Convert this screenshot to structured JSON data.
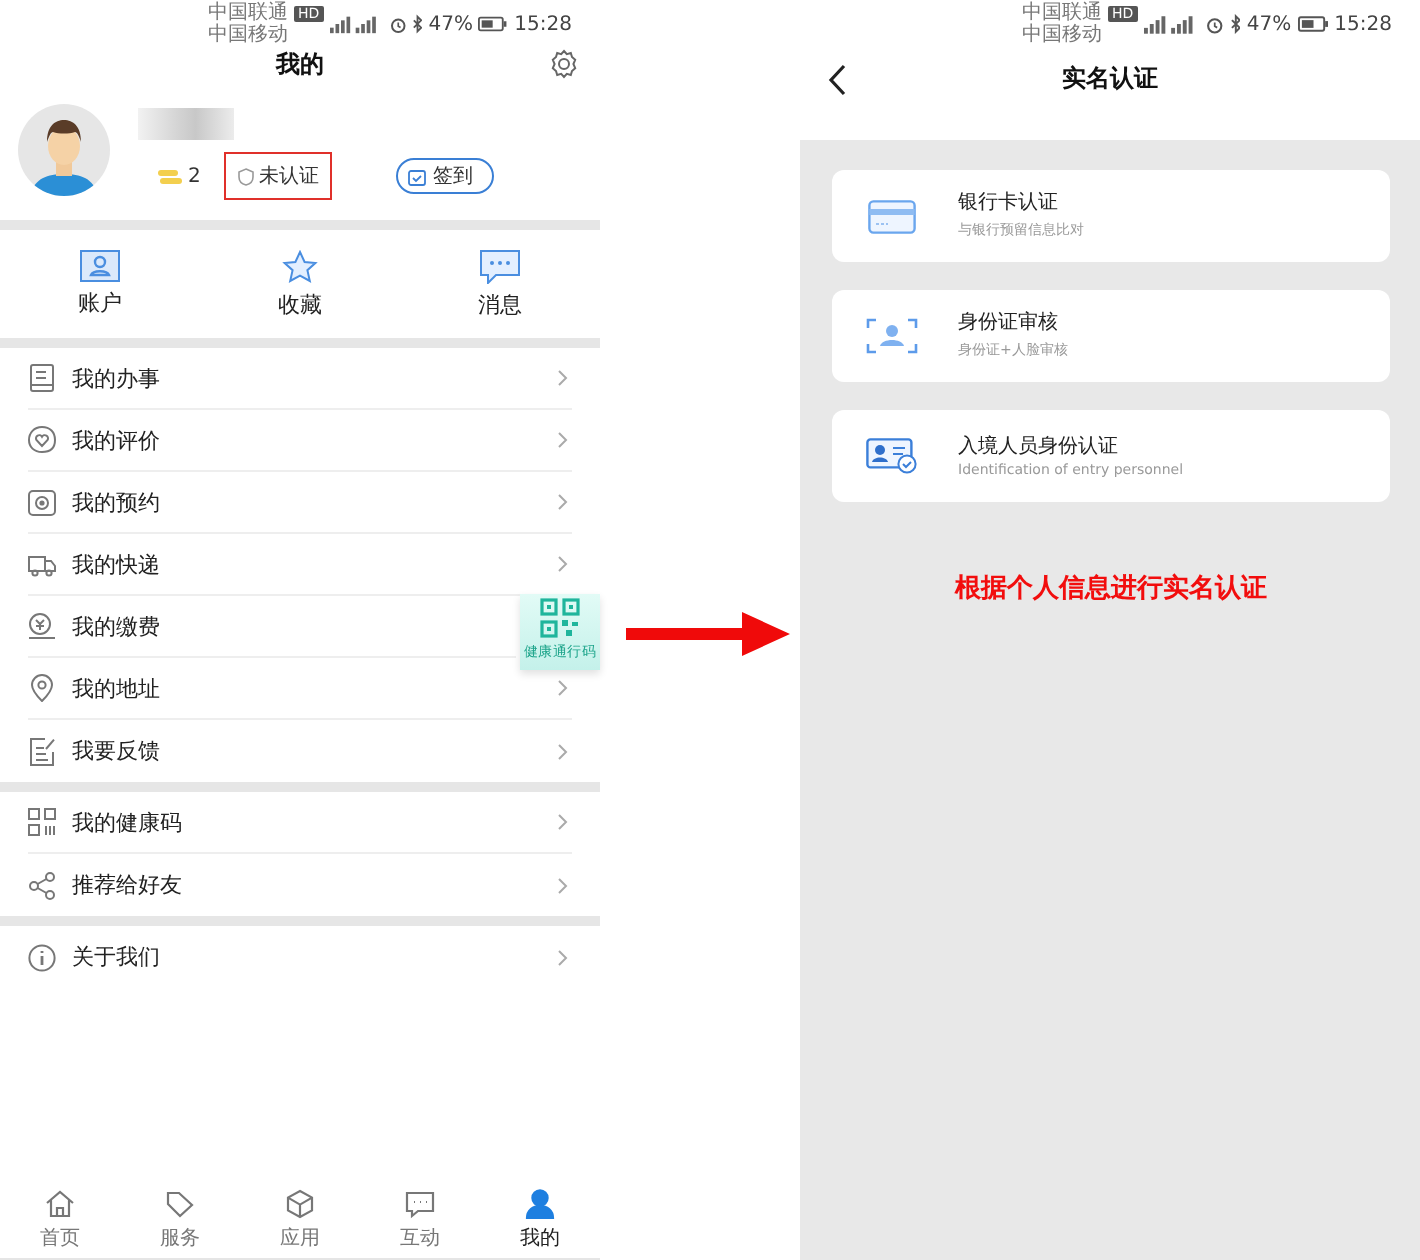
{
  "left_screen": {
    "status_bar": {
      "carriers": [
        "中国联通",
        "中国移动"
      ],
      "hd": "HD",
      "battery": "47%",
      "time": "15:28"
    },
    "title": "我的",
    "profile": {
      "coins": "2",
      "verification": "未认证",
      "checkin": "签到"
    },
    "shortcuts": [
      {
        "label": "账户"
      },
      {
        "label": "收藏"
      },
      {
        "label": "消息"
      }
    ],
    "menu_groups": [
      {
        "items": [
          {
            "label": "我的办事"
          },
          {
            "label": "我的评价"
          },
          {
            "label": "我的预约"
          },
          {
            "label": "我的快递"
          },
          {
            "label": "我的缴费"
          },
          {
            "label": "我的地址"
          },
          {
            "label": "我要反馈"
          }
        ]
      },
      {
        "items": [
          {
            "label": "我的健康码"
          },
          {
            "label": "推荐给好友"
          }
        ]
      },
      {
        "items": [
          {
            "label": "关于我们"
          }
        ]
      }
    ],
    "health_badge": "健康通行码",
    "bottom_nav": [
      {
        "label": "首页",
        "selected": false
      },
      {
        "label": "服务",
        "selected": false
      },
      {
        "label": "应用",
        "selected": false
      },
      {
        "label": "互动",
        "selected": false
      },
      {
        "label": "我的",
        "selected": true
      }
    ]
  },
  "right_screen": {
    "status_bar": {
      "carriers": [
        "中国联通",
        "中国移动"
      ],
      "hd": "HD",
      "battery": "47%",
      "time": "15:28"
    },
    "title": "实名认证",
    "cards": [
      {
        "title": "银行卡认证",
        "subtitle": "与银行预留信息比对"
      },
      {
        "title": "身份证审核",
        "subtitle": "身份证+人脸审核"
      },
      {
        "title": "入境人员身份认证",
        "subtitle": "Identification of entry personnel"
      }
    ],
    "note": "根据个人信息进行实名认证"
  }
}
